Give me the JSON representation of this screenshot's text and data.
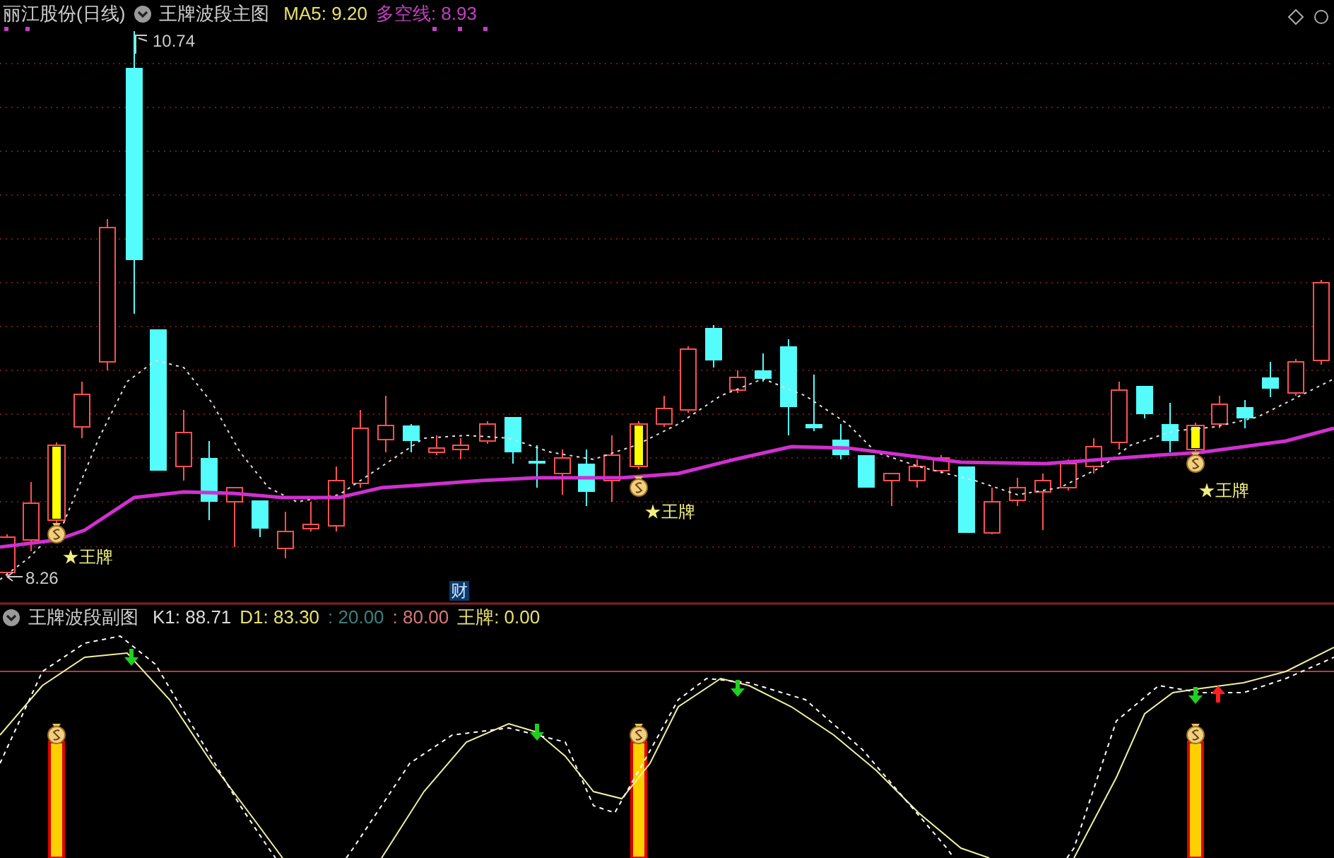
{
  "main_chart": {
    "title": "丽江股份(日线)",
    "indicator": "王牌波段主图",
    "ma5": "MA5: 9.20",
    "trend_line": "多空线: 8.93",
    "high_label": "10.74",
    "low_label": "8.26",
    "marker": "财",
    "signal_labels": [
      "★王牌",
      "★王牌",
      "★王牌"
    ]
  },
  "sub_chart": {
    "indicator": "王牌波段副图",
    "values": [
      {
        "text": "K1: 88.71",
        "color": "#dcdcdc"
      },
      {
        "text": "D1: 83.30",
        "color": "#e8e070"
      },
      {
        "text": ": 20.00",
        "color": "#3f7f7f"
      },
      {
        "text": ": 80.00",
        "color": "#d87878"
      },
      {
        "text": "王牌: 0.00",
        "color": "#e8e070"
      }
    ]
  }
}
